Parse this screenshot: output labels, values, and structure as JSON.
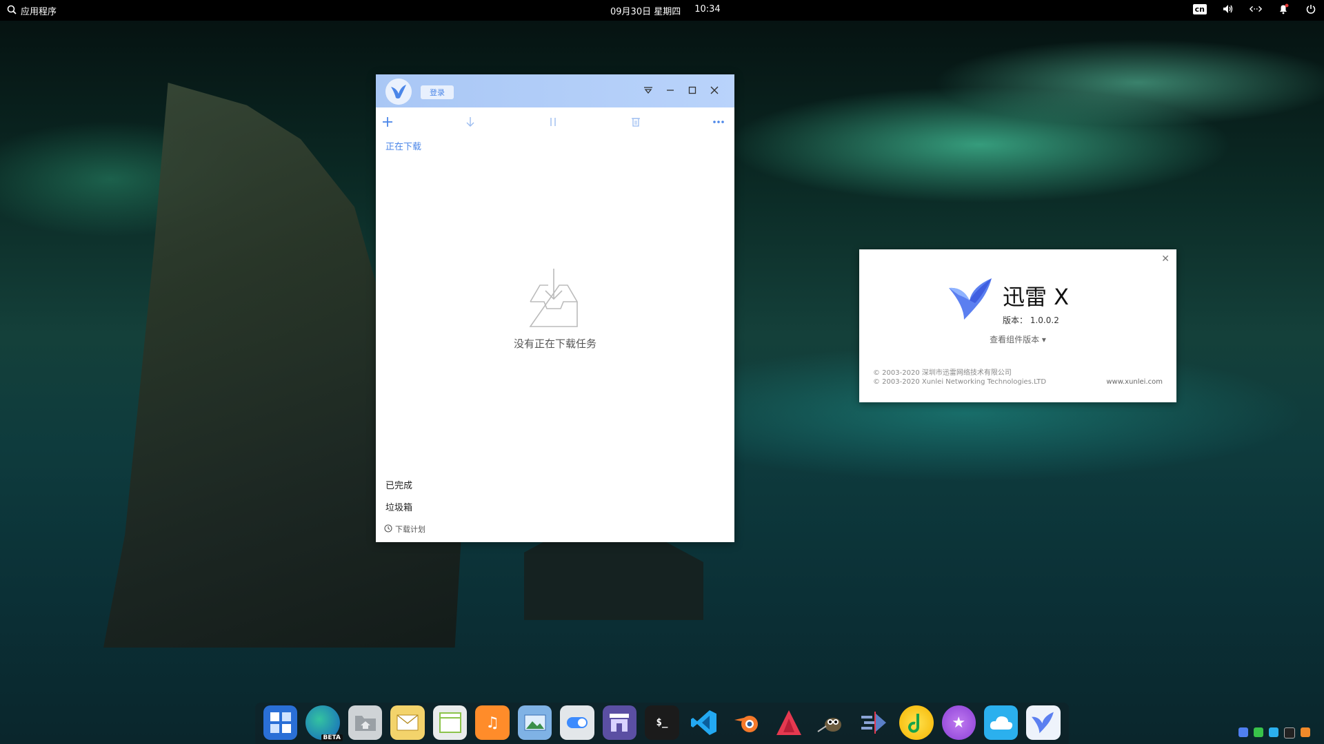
{
  "topbar": {
    "apps_label": "应用程序",
    "date": "09月30日 星期四",
    "time": "10:34",
    "input_method": "cn"
  },
  "xunlei_window": {
    "login_label": "登录",
    "tab_downloading": "正在下载",
    "empty_message": "没有正在下载任务",
    "completed": "已完成",
    "trash": "垃圾箱",
    "download_plan": "下载计划"
  },
  "about_dialog": {
    "product_name": "迅雷 X",
    "version_label": "版本：",
    "version": "1.0.0.2",
    "components_label": "查看组件版本",
    "copyright_cn": "© 2003-2020 深圳市迅雷网络技术有限公司",
    "copyright_en": "© 2003-2020 Xunlei Networking Technologies.LTD",
    "website": "www.xunlei.com"
  },
  "dock": {
    "edge_badge": "BETA",
    "terminal_text": "$_"
  },
  "colors": {
    "accent": "#4b86e8",
    "header_bg": "#b9d3fb"
  }
}
